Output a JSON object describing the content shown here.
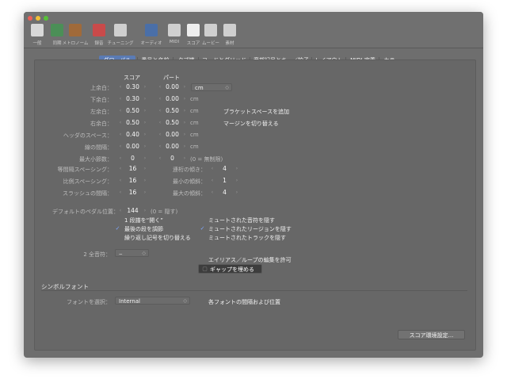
{
  "toolbar": [
    {
      "label": "一般",
      "icon": "switch-icon",
      "color": "#d8d8d8"
    },
    {
      "label": "同期",
      "icon": "sync-icon",
      "color": "#4b8f57"
    },
    {
      "label": "メトロノーム",
      "icon": "metronome-icon",
      "color": "#a06a3a"
    },
    {
      "label": "録音",
      "icon": "record-icon",
      "color": "#c94a4a"
    },
    {
      "label": "チューニング",
      "icon": "tuning-fork-icon",
      "color": "#cfcfcf"
    },
    {
      "label": "オーディオ",
      "icon": "audio-wave-icon",
      "color": "#4a6fa8"
    },
    {
      "label": "MIDI",
      "icon": "midi-icon",
      "color": "#cfcfcf"
    },
    {
      "label": "スコア",
      "icon": "score-note-icon",
      "color": "#eeeeee"
    },
    {
      "label": "ムービー",
      "icon": "movie-icon",
      "color": "#cfcfcf"
    },
    {
      "label": "素材",
      "icon": "briefcase-icon",
      "color": "#cfcfcf"
    }
  ],
  "tabs": [
    {
      "label": "グローバル",
      "selected": true
    },
    {
      "label": "番号と名前",
      "selected": false
    },
    {
      "label": "タブ譜",
      "selected": false
    },
    {
      "label": "コードとグリッド",
      "selected": false
    },
    {
      "label": "音部記号とキー／拍子",
      "selected": false
    },
    {
      "label": "レイアウト",
      "selected": false
    },
    {
      "label": "MIDI 定義",
      "selected": false
    },
    {
      "label": "カラー",
      "selected": false
    }
  ],
  "headers": {
    "score": "スコア",
    "part": "パート"
  },
  "margins": [
    {
      "label": "上余白：",
      "score": "0.30",
      "part": "0.00",
      "unit": "cm",
      "popup": true
    },
    {
      "label": "下余白：",
      "score": "0.30",
      "part": "0.00",
      "unit": "cm"
    },
    {
      "label": "左余白：",
      "score": "0.50",
      "part": "0.50",
      "unit": "cm",
      "check": "ブラケットスペースを追加"
    },
    {
      "label": "右余白：",
      "score": "0.50",
      "part": "0.50",
      "unit": "cm",
      "check": "マージンを切り替える"
    },
    {
      "label": "ヘッダのスペース：",
      "score": "0.40",
      "part": "0.00",
      "unit": "cm"
    },
    {
      "label": "線の間隔：",
      "score": "0.00",
      "part": "0.00",
      "unit": "cm"
    },
    {
      "label": "最大小節数：",
      "score": "0",
      "part": "0",
      "unit": "(0 = 無制限)"
    }
  ],
  "spacing": [
    {
      "label": "等間隔スペーシング：",
      "value": "16",
      "label2": "連桁の傾き：",
      "value2": "4"
    },
    {
      "label": "比例スペーシング：",
      "value": "16",
      "label2": "最小の傾斜：",
      "value2": "1"
    },
    {
      "label": "スラッシュの間隔：",
      "value": "16",
      "label2": "最大の傾斜：",
      "value2": "4"
    }
  ],
  "pedal": {
    "label": "デフォルトのペダル位置：",
    "value": "144",
    "note": "(0 = 隠す)"
  },
  "checks_left": [
    {
      "label": "1 段譜を“開く”",
      "checked": false
    },
    {
      "label": "最後の段を調節",
      "checked": true
    },
    {
      "label": "繰り返し記号を切り替える",
      "checked": false
    }
  ],
  "checks_right": [
    {
      "label": "ミュートされた音符を隠す",
      "checked": false
    },
    {
      "label": "ミュートされたリージョンを隠す",
      "checked": true
    },
    {
      "label": "ミュートされたトラックを隠す",
      "checked": false
    }
  ],
  "whole_rest": {
    "label": "2 全音符：",
    "value": "‒"
  },
  "alias_label": "エイリアス／ループの編集を許可",
  "gap_button": "ギャップを埋める",
  "symbol_section": "シンボルフォント",
  "font_select": {
    "label": "フォントを選択：",
    "value": "Internal"
  },
  "font_note": "各フォントの間隔および位置",
  "prefs_button": "スコア環境設定..."
}
